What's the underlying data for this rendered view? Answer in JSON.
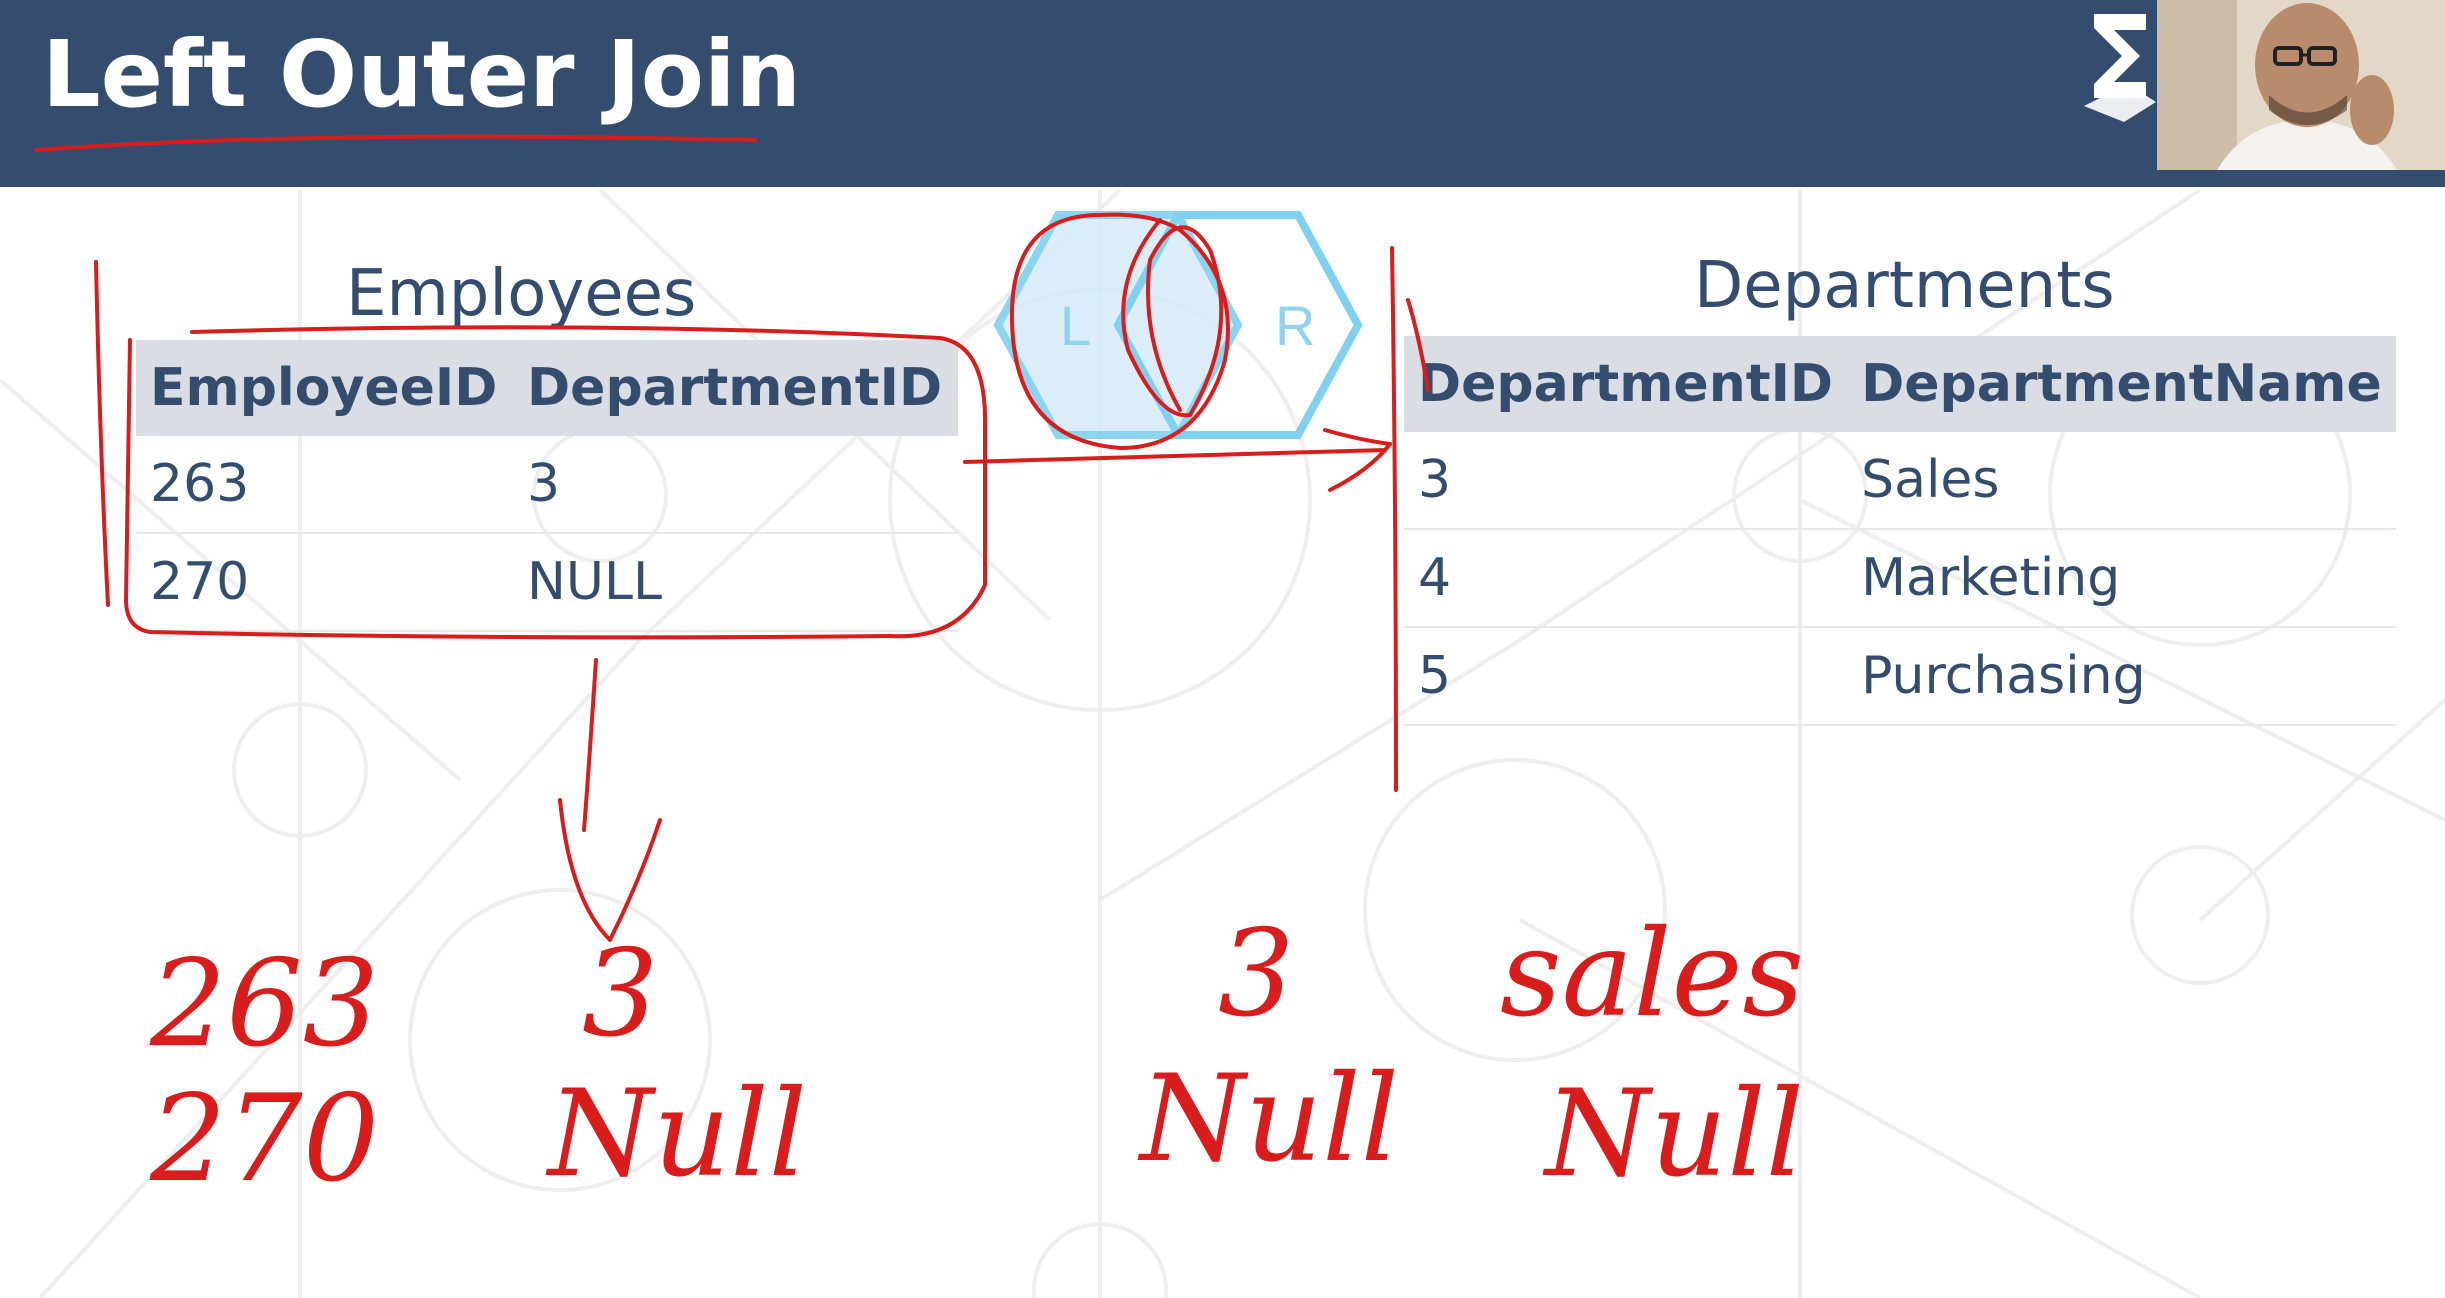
{
  "slide": {
    "title": "Left Outer Join"
  },
  "colors": {
    "header_bg": "#344d6e",
    "table_header_bg": "#dadde3",
    "ink": "#d91c1c",
    "venn_stroke": "#7fd1ef",
    "venn_fill": "#d6ecf8"
  },
  "venn": {
    "left_label": "L",
    "right_label": "R"
  },
  "employees": {
    "caption": "Employees",
    "columns": [
      "EmployeeID",
      "DepartmentID"
    ],
    "rows": [
      [
        "263",
        "3"
      ],
      [
        "270",
        "NULL"
      ]
    ]
  },
  "departments": {
    "caption": "Departments",
    "columns": [
      "DepartmentID",
      "DepartmentName"
    ],
    "rows": [
      [
        "3",
        "Sales"
      ],
      [
        "4",
        "Marketing"
      ],
      [
        "5",
        "Purchasing"
      ]
    ]
  },
  "annotations": {
    "left_ids": [
      "263",
      "270"
    ],
    "left_dept": [
      "3",
      "Null"
    ],
    "right_ids": [
      "3",
      "Null"
    ],
    "right_names": [
      "sales",
      "Null"
    ]
  },
  "icons": {
    "logo": "brand-logo-icon",
    "webcam": "presenter-webcam"
  }
}
